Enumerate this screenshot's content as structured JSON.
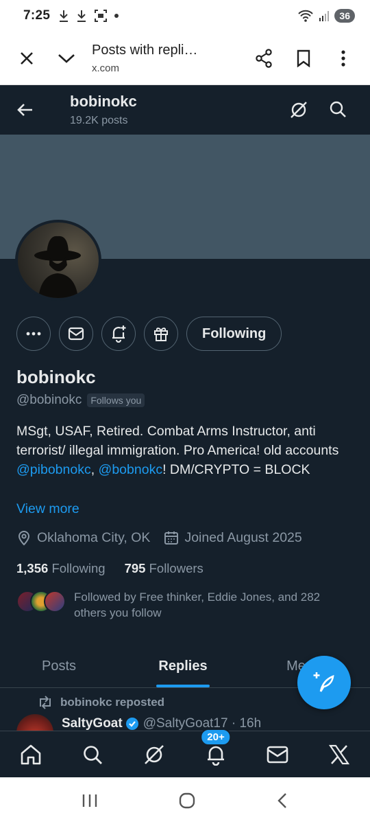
{
  "status_bar": {
    "time": "7:25",
    "battery": "36",
    "icons": [
      "download-icon",
      "download-icon",
      "screenshot-icon",
      "dot-icon",
      "wifi-icon",
      "signal-icon"
    ]
  },
  "browser_tab": {
    "title": "Posts with repli…",
    "url": "x.com"
  },
  "profile_header": {
    "name": "bobinokc",
    "posts": "19.2K posts"
  },
  "profile": {
    "display_name": "bobinokc",
    "handle": "@bobinokc",
    "follows_you": "Follows you",
    "following_button": "Following",
    "bio": {
      "part1": "MSgt, USAF, Retired. Combat Arms Instructor, anti terrorist/ illegal immigration. Pro America! old accounts ",
      "link1": "@pibobnokc",
      "sep": ", ",
      "link2": "@bobnokc",
      "part2": "! DM/CRYPTO = BLOCK"
    },
    "view_more": "View more",
    "location": "Oklahoma City, OK",
    "joined": "Joined August 2025",
    "following_count": "1,356",
    "following_label": "Following",
    "followers_count": "795",
    "followers_label": "Followers",
    "followed_by": "Followed by Free thinker, Eddie Jones, and 282 others you follow"
  },
  "tabs": [
    {
      "label": "Posts"
    },
    {
      "label": "Replies"
    },
    {
      "label": "Me"
    }
  ],
  "post": {
    "repost_label": "bobinokc reposted",
    "author": "SaltyGoat",
    "handle": "@SaltyGoat17 · 16h"
  },
  "bottom_nav": {
    "badge": "20+"
  },
  "colors": {
    "background": "#15202b",
    "accent": "#1d9bf0",
    "banner": "#425664",
    "muted": "#8b98a5"
  }
}
